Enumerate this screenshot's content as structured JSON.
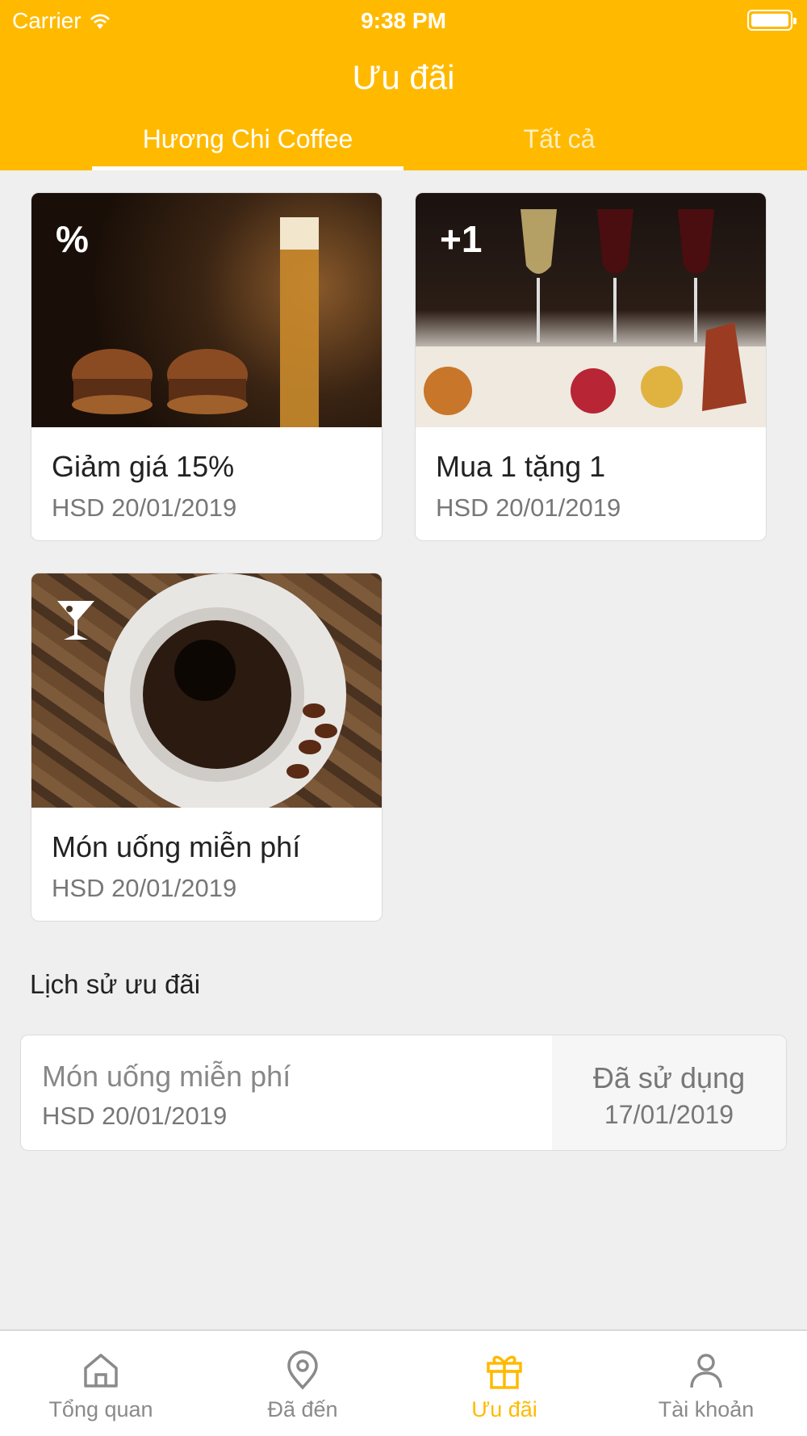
{
  "status_bar": {
    "carrier": "Carrier",
    "time": "9:38 PM"
  },
  "header": {
    "title": "Ưu đãi"
  },
  "tabs": [
    {
      "label": "Hương Chi Coffee",
      "active": true
    },
    {
      "label": "Tất cả",
      "active": false
    }
  ],
  "offers": [
    {
      "badge": "%",
      "title": "Giảm giá 15%",
      "expiry": "HSD 20/01/2019",
      "icon": "percent-icon"
    },
    {
      "badge": "+1",
      "title": "Mua 1 tặng 1",
      "expiry": "HSD 20/01/2019",
      "icon": "plus-one-icon"
    },
    {
      "badge": "🍸",
      "title": "Món uống miễn phí",
      "expiry": "HSD 20/01/2019",
      "icon": "cocktail-icon"
    }
  ],
  "history": {
    "title": "Lịch sử ưu đãi",
    "items": [
      {
        "title": "Món uống miễn phí",
        "expiry": "HSD 20/01/2019",
        "status": "Đã sử dụng",
        "used_date": "17/01/2019"
      }
    ]
  },
  "tabbar": [
    {
      "label": "Tổng quan",
      "icon": "home-icon",
      "active": false
    },
    {
      "label": "Đã đến",
      "icon": "location-pin-icon",
      "active": false
    },
    {
      "label": "Ưu đãi",
      "icon": "gift-icon",
      "active": true
    },
    {
      "label": "Tài khoản",
      "icon": "user-icon",
      "active": false
    }
  ],
  "colors": {
    "accent": "#ffba00",
    "background": "#efefef"
  }
}
